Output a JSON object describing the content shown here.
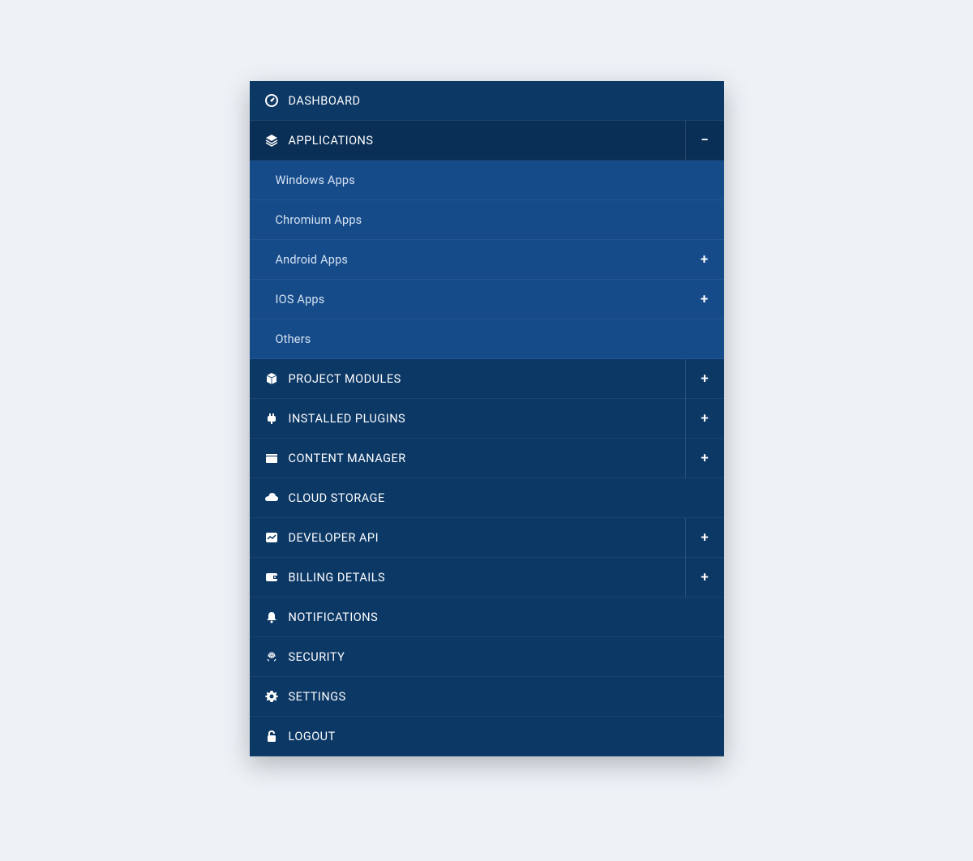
{
  "menu": {
    "items": [
      {
        "id": "dashboard",
        "label": "DASHBOARD",
        "icon": "gauge",
        "expandable": false
      },
      {
        "id": "applications",
        "label": "APPLICATIONS",
        "icon": "layers",
        "expandable": true,
        "expanded": true,
        "children": [
          {
            "id": "windows-apps",
            "label": "Windows Apps",
            "expandable": false
          },
          {
            "id": "chromium-apps",
            "label": "Chromium Apps",
            "expandable": false
          },
          {
            "id": "android-apps",
            "label": "Android Apps",
            "expandable": true
          },
          {
            "id": "ios-apps",
            "label": "IOS Apps",
            "expandable": true
          },
          {
            "id": "others",
            "label": "Others",
            "expandable": false
          }
        ]
      },
      {
        "id": "project-modules",
        "label": "PROJECT MODULES",
        "icon": "cube",
        "expandable": true
      },
      {
        "id": "installed-plugins",
        "label": "INSTALLED PLUGINS",
        "icon": "plug",
        "expandable": true
      },
      {
        "id": "content-manager",
        "label": "CONTENT MANAGER",
        "icon": "folder",
        "expandable": true
      },
      {
        "id": "cloud-storage",
        "label": "CLOUD STORAGE",
        "icon": "cloud",
        "expandable": false
      },
      {
        "id": "developer-api",
        "label": "DEVELOPER API",
        "icon": "chart",
        "expandable": true
      },
      {
        "id": "billing-details",
        "label": "BILLING DETAILS",
        "icon": "wallet",
        "expandable": true
      },
      {
        "id": "notifications",
        "label": "NOTIFICATIONS",
        "icon": "bell",
        "expandable": false
      },
      {
        "id": "security",
        "label": "SECURITY",
        "icon": "fingerprint",
        "expandable": false
      },
      {
        "id": "settings",
        "label": "SETTINGS",
        "icon": "gear",
        "expandable": false
      },
      {
        "id": "logout",
        "label": "LOGOUT",
        "icon": "lock",
        "expandable": false
      }
    ]
  },
  "symbols": {
    "plus": "+",
    "minus": "−"
  }
}
